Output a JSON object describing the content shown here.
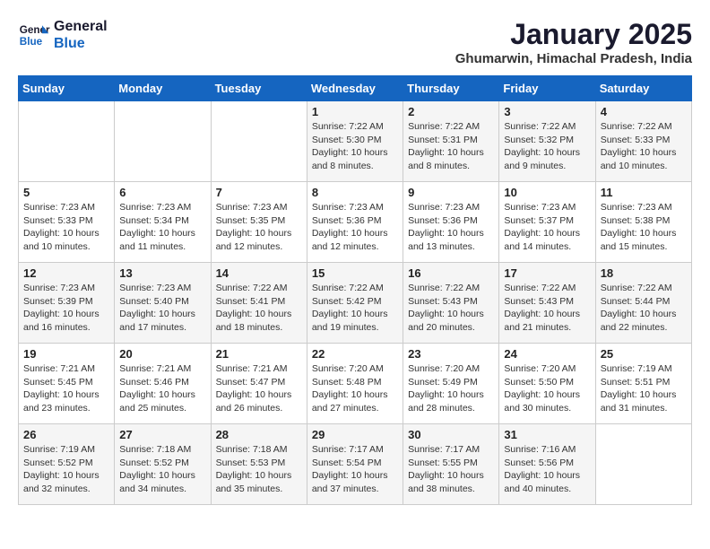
{
  "logo": {
    "line1": "General",
    "line2": "Blue"
  },
  "title": "January 2025",
  "subtitle": "Ghumarwin, Himachal Pradesh, India",
  "days_of_week": [
    "Sunday",
    "Monday",
    "Tuesday",
    "Wednesday",
    "Thursday",
    "Friday",
    "Saturday"
  ],
  "weeks": [
    [
      {
        "day": "",
        "info": ""
      },
      {
        "day": "",
        "info": ""
      },
      {
        "day": "",
        "info": ""
      },
      {
        "day": "1",
        "info": "Sunrise: 7:22 AM\nSunset: 5:30 PM\nDaylight: 10 hours and 8 minutes."
      },
      {
        "day": "2",
        "info": "Sunrise: 7:22 AM\nSunset: 5:31 PM\nDaylight: 10 hours and 8 minutes."
      },
      {
        "day": "3",
        "info": "Sunrise: 7:22 AM\nSunset: 5:32 PM\nDaylight: 10 hours and 9 minutes."
      },
      {
        "day": "4",
        "info": "Sunrise: 7:22 AM\nSunset: 5:33 PM\nDaylight: 10 hours and 10 minutes."
      }
    ],
    [
      {
        "day": "5",
        "info": "Sunrise: 7:23 AM\nSunset: 5:33 PM\nDaylight: 10 hours and 10 minutes."
      },
      {
        "day": "6",
        "info": "Sunrise: 7:23 AM\nSunset: 5:34 PM\nDaylight: 10 hours and 11 minutes."
      },
      {
        "day": "7",
        "info": "Sunrise: 7:23 AM\nSunset: 5:35 PM\nDaylight: 10 hours and 12 minutes."
      },
      {
        "day": "8",
        "info": "Sunrise: 7:23 AM\nSunset: 5:36 PM\nDaylight: 10 hours and 12 minutes."
      },
      {
        "day": "9",
        "info": "Sunrise: 7:23 AM\nSunset: 5:36 PM\nDaylight: 10 hours and 13 minutes."
      },
      {
        "day": "10",
        "info": "Sunrise: 7:23 AM\nSunset: 5:37 PM\nDaylight: 10 hours and 14 minutes."
      },
      {
        "day": "11",
        "info": "Sunrise: 7:23 AM\nSunset: 5:38 PM\nDaylight: 10 hours and 15 minutes."
      }
    ],
    [
      {
        "day": "12",
        "info": "Sunrise: 7:23 AM\nSunset: 5:39 PM\nDaylight: 10 hours and 16 minutes."
      },
      {
        "day": "13",
        "info": "Sunrise: 7:23 AM\nSunset: 5:40 PM\nDaylight: 10 hours and 17 minutes."
      },
      {
        "day": "14",
        "info": "Sunrise: 7:22 AM\nSunset: 5:41 PM\nDaylight: 10 hours and 18 minutes."
      },
      {
        "day": "15",
        "info": "Sunrise: 7:22 AM\nSunset: 5:42 PM\nDaylight: 10 hours and 19 minutes."
      },
      {
        "day": "16",
        "info": "Sunrise: 7:22 AM\nSunset: 5:43 PM\nDaylight: 10 hours and 20 minutes."
      },
      {
        "day": "17",
        "info": "Sunrise: 7:22 AM\nSunset: 5:43 PM\nDaylight: 10 hours and 21 minutes."
      },
      {
        "day": "18",
        "info": "Sunrise: 7:22 AM\nSunset: 5:44 PM\nDaylight: 10 hours and 22 minutes."
      }
    ],
    [
      {
        "day": "19",
        "info": "Sunrise: 7:21 AM\nSunset: 5:45 PM\nDaylight: 10 hours and 23 minutes."
      },
      {
        "day": "20",
        "info": "Sunrise: 7:21 AM\nSunset: 5:46 PM\nDaylight: 10 hours and 25 minutes."
      },
      {
        "day": "21",
        "info": "Sunrise: 7:21 AM\nSunset: 5:47 PM\nDaylight: 10 hours and 26 minutes."
      },
      {
        "day": "22",
        "info": "Sunrise: 7:20 AM\nSunset: 5:48 PM\nDaylight: 10 hours and 27 minutes."
      },
      {
        "day": "23",
        "info": "Sunrise: 7:20 AM\nSunset: 5:49 PM\nDaylight: 10 hours and 28 minutes."
      },
      {
        "day": "24",
        "info": "Sunrise: 7:20 AM\nSunset: 5:50 PM\nDaylight: 10 hours and 30 minutes."
      },
      {
        "day": "25",
        "info": "Sunrise: 7:19 AM\nSunset: 5:51 PM\nDaylight: 10 hours and 31 minutes."
      }
    ],
    [
      {
        "day": "26",
        "info": "Sunrise: 7:19 AM\nSunset: 5:52 PM\nDaylight: 10 hours and 32 minutes."
      },
      {
        "day": "27",
        "info": "Sunrise: 7:18 AM\nSunset: 5:52 PM\nDaylight: 10 hours and 34 minutes."
      },
      {
        "day": "28",
        "info": "Sunrise: 7:18 AM\nSunset: 5:53 PM\nDaylight: 10 hours and 35 minutes."
      },
      {
        "day": "29",
        "info": "Sunrise: 7:17 AM\nSunset: 5:54 PM\nDaylight: 10 hours and 37 minutes."
      },
      {
        "day": "30",
        "info": "Sunrise: 7:17 AM\nSunset: 5:55 PM\nDaylight: 10 hours and 38 minutes."
      },
      {
        "day": "31",
        "info": "Sunrise: 7:16 AM\nSunset: 5:56 PM\nDaylight: 10 hours and 40 minutes."
      },
      {
        "day": "",
        "info": ""
      }
    ]
  ]
}
